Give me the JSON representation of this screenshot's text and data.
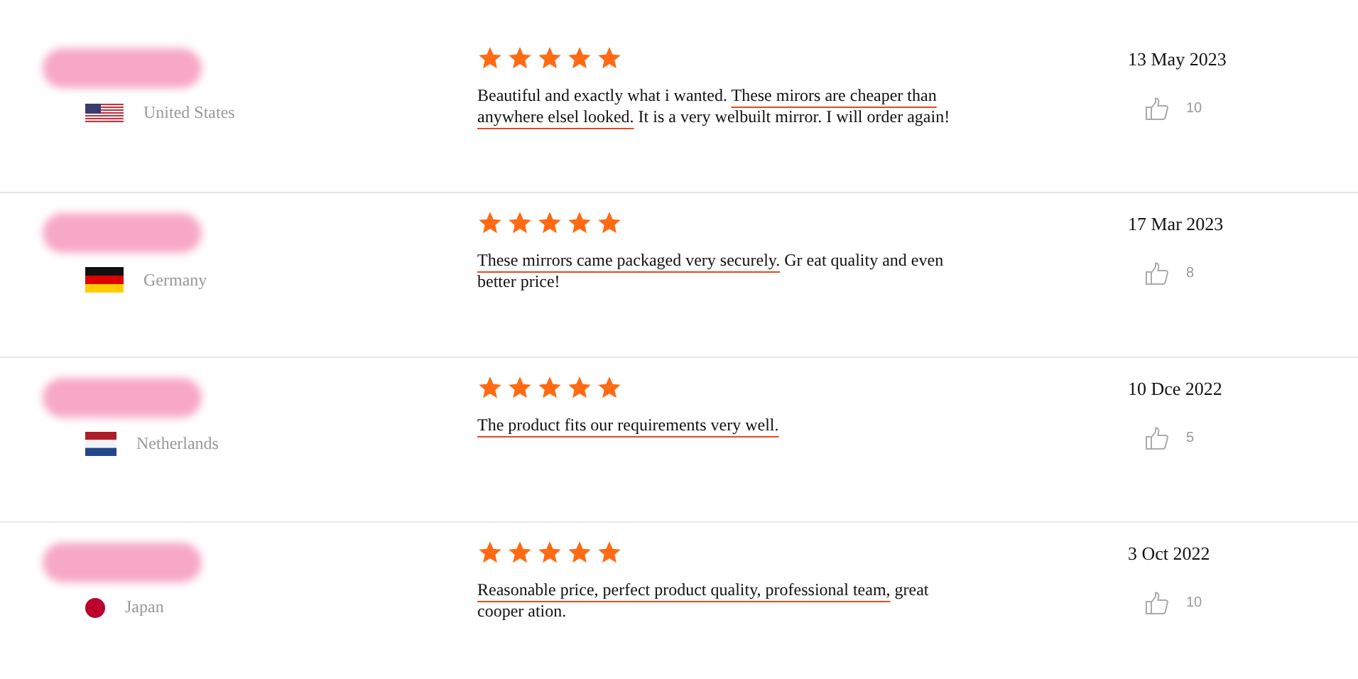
{
  "reviews": [
    {
      "country": "United States",
      "kind": "us",
      "stars": 5,
      "date": "13 May 2023",
      "likes": "10",
      "text": [
        {
          "text": "Beautiful and exactly what i wanted. ",
          "underlined": false
        },
        {
          "text": "These mirors are cheaper than anywhere elsel looked.",
          "underlined": true
        },
        {
          "text": " It is a very welbuilt mirror. I will order again!",
          "underlined": false
        }
      ]
    },
    {
      "country": "Germany",
      "kind": "de",
      "stars": 5,
      "date": "17 Mar 2023",
      "likes": "8",
      "text": [
        {
          "text": "These mirrors came packaged very securely.",
          "underlined": true
        },
        {
          "text": " Gr eat quality and even better price!",
          "underlined": false
        }
      ]
    },
    {
      "country": "Netherlands",
      "kind": "nl",
      "stars": 5,
      "date": "10 Dce 2022",
      "likes": "5",
      "text": [
        {
          "text": "The product fits our requirements very well.",
          "underlined": true
        }
      ]
    },
    {
      "country": "Japan",
      "kind": "jp",
      "stars": 5,
      "date": "3 Oct  2022",
      "likes": "10",
      "text": [
        {
          "text": "Reasonable price, perfect product quality, professional team,",
          "underlined": true
        },
        {
          "text": " great cooper ation.",
          "underlined": false
        }
      ]
    }
  ]
}
